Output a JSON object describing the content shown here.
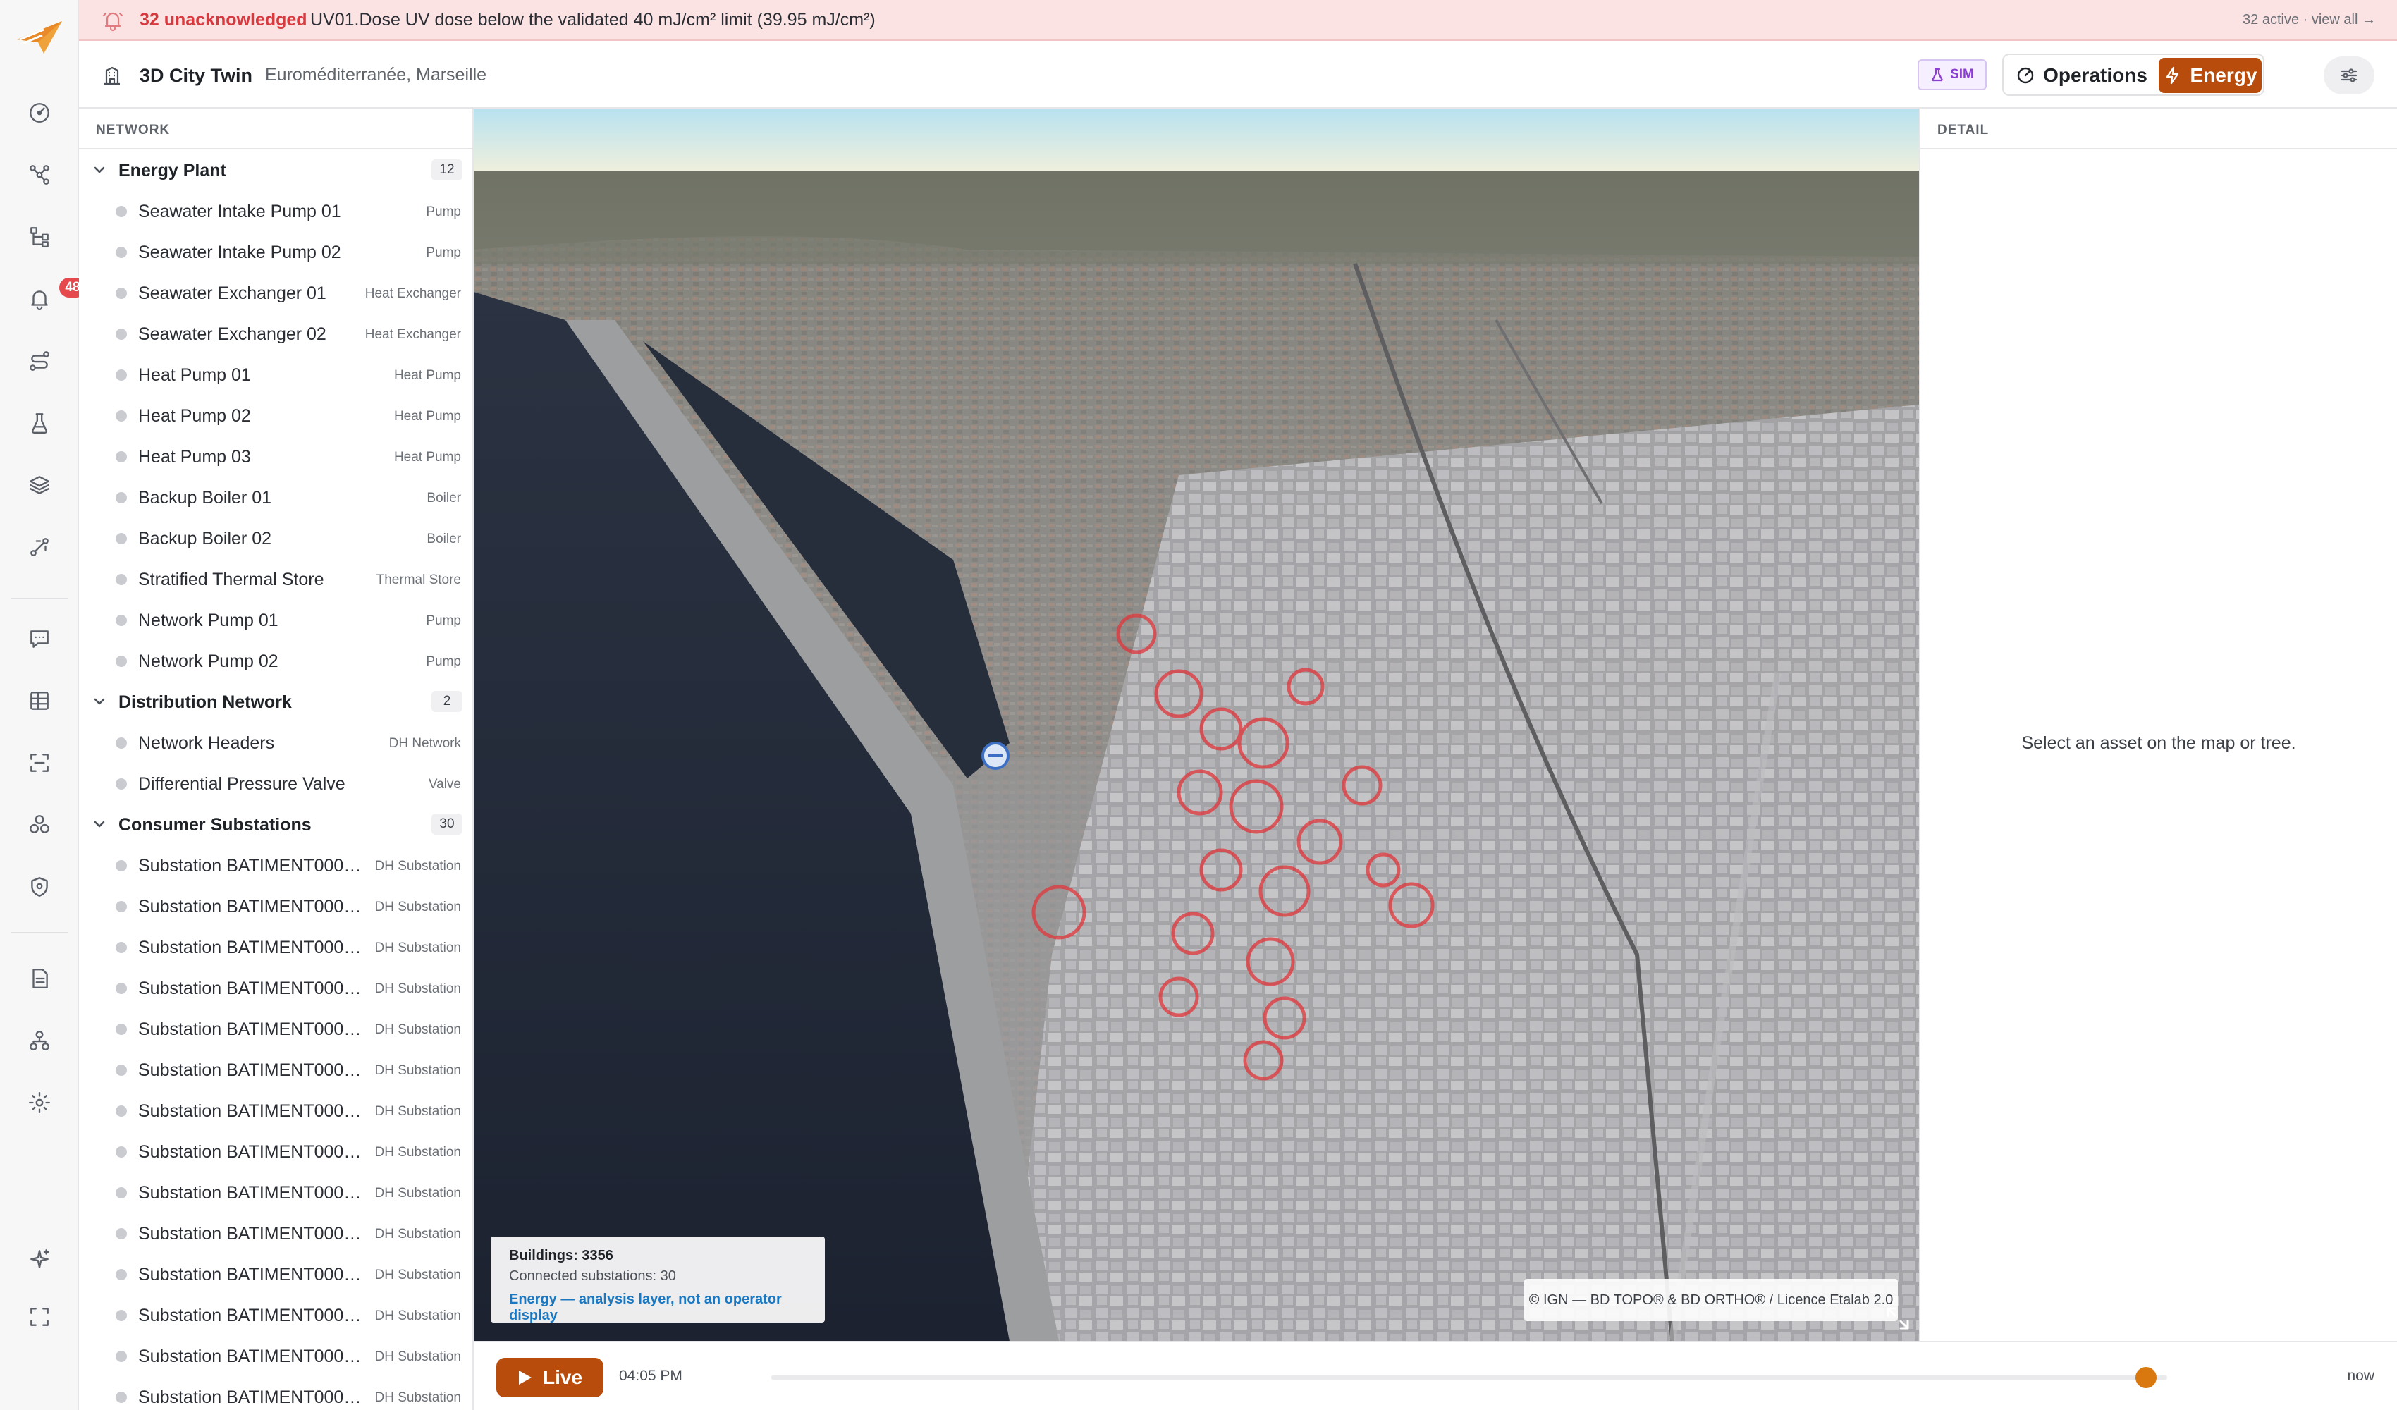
{
  "banner": {
    "count": "32 unacknowledged",
    "message": "UV01.Dose UV dose below the validated 40 mJ/cm² limit (39.95 mJ/cm²)",
    "view_all": "32 active · view all →",
    "color": "#d63a3f"
  },
  "rail": {
    "badge": "48",
    "icons": [
      "logo-icon",
      "dashboard-icon",
      "network-icon",
      "hierarchy-icon",
      "alarm-bell-icon",
      "routes-icon",
      "lab-flask-icon",
      "layers-icon",
      "pipeline-icon",
      "chat-icon",
      "grid-icon",
      "scan-icon",
      "components-icon",
      "shield-icon",
      "document-icon",
      "org-chart-icon",
      "settings-icon",
      "sparkles-icon",
      "fullscreen-icon"
    ]
  },
  "header": {
    "title": "3D City Twin",
    "subtitle": "Euroméditerranée, Marseille",
    "sim_badge": "SIM",
    "mode_operations": "Operations",
    "mode_energy": "Energy",
    "accent_color": "#b84c0c"
  },
  "tree": {
    "heading": "NETWORK",
    "groups": [
      {
        "name": "Energy Plant",
        "count": "12",
        "items": [
          {
            "name": "Seawater Intake Pump 01",
            "type": "Pump"
          },
          {
            "name": "Seawater Intake Pump 02",
            "type": "Pump"
          },
          {
            "name": "Seawater Exchanger 01",
            "type": "Heat Exchanger"
          },
          {
            "name": "Seawater Exchanger 02",
            "type": "Heat Exchanger"
          },
          {
            "name": "Heat Pump 01",
            "type": "Heat Pump"
          },
          {
            "name": "Heat Pump 02",
            "type": "Heat Pump"
          },
          {
            "name": "Heat Pump 03",
            "type": "Heat Pump"
          },
          {
            "name": "Backup Boiler 01",
            "type": "Boiler"
          },
          {
            "name": "Backup Boiler 02",
            "type": "Boiler"
          },
          {
            "name": "Stratified Thermal Store",
            "type": "Thermal Store"
          },
          {
            "name": "Network Pump 01",
            "type": "Pump"
          },
          {
            "name": "Network Pump 02",
            "type": "Pump"
          }
        ]
      },
      {
        "name": "Distribution Network",
        "count": "2",
        "items": [
          {
            "name": "Network Headers",
            "type": "DH Network"
          },
          {
            "name": "Differential Pressure Valve",
            "type": "Valve"
          }
        ]
      },
      {
        "name": "Consumer Substations",
        "count": "30",
        "items": [
          {
            "name": "Substation BATIMENT0000...",
            "type": "DH Substation"
          },
          {
            "name": "Substation BATIMENT0000...",
            "type": "DH Substation"
          },
          {
            "name": "Substation BATIMENT0000...",
            "type": "DH Substation"
          },
          {
            "name": "Substation BATIMENT0000...",
            "type": "DH Substation"
          },
          {
            "name": "Substation BATIMENT0000...",
            "type": "DH Substation"
          },
          {
            "name": "Substation BATIMENT0000...",
            "type": "DH Substation"
          },
          {
            "name": "Substation BATIMENT0000...",
            "type": "DH Substation"
          },
          {
            "name": "Substation BATIMENT0000...",
            "type": "DH Substation"
          },
          {
            "name": "Substation BATIMENT0000...",
            "type": "DH Substation"
          },
          {
            "name": "Substation BATIMENT0000...",
            "type": "DH Substation"
          },
          {
            "name": "Substation BATIMENT0000...",
            "type": "DH Substation"
          },
          {
            "name": "Substation BATIMENT0000...",
            "type": "DH Substation"
          },
          {
            "name": "Substation BATIMENT0000...",
            "type": "DH Substation"
          },
          {
            "name": "Substation BATIMENT0000...",
            "type": "DH Substation"
          }
        ]
      }
    ]
  },
  "map": {
    "buildings": "Buildings: 3356",
    "connected": "Connected substations: 30",
    "layer_note": "Energy — analysis layer, not an operator display",
    "attribution": "© IGN — BD TOPO® & BD ORTHO® / Licence Etalab 2.0"
  },
  "detail": {
    "heading": "DETAIL",
    "empty": "Select an asset on the map or tree."
  },
  "timeline": {
    "live": "Live",
    "time": "04:05 PM",
    "now": "now",
    "progress": 0.985
  }
}
